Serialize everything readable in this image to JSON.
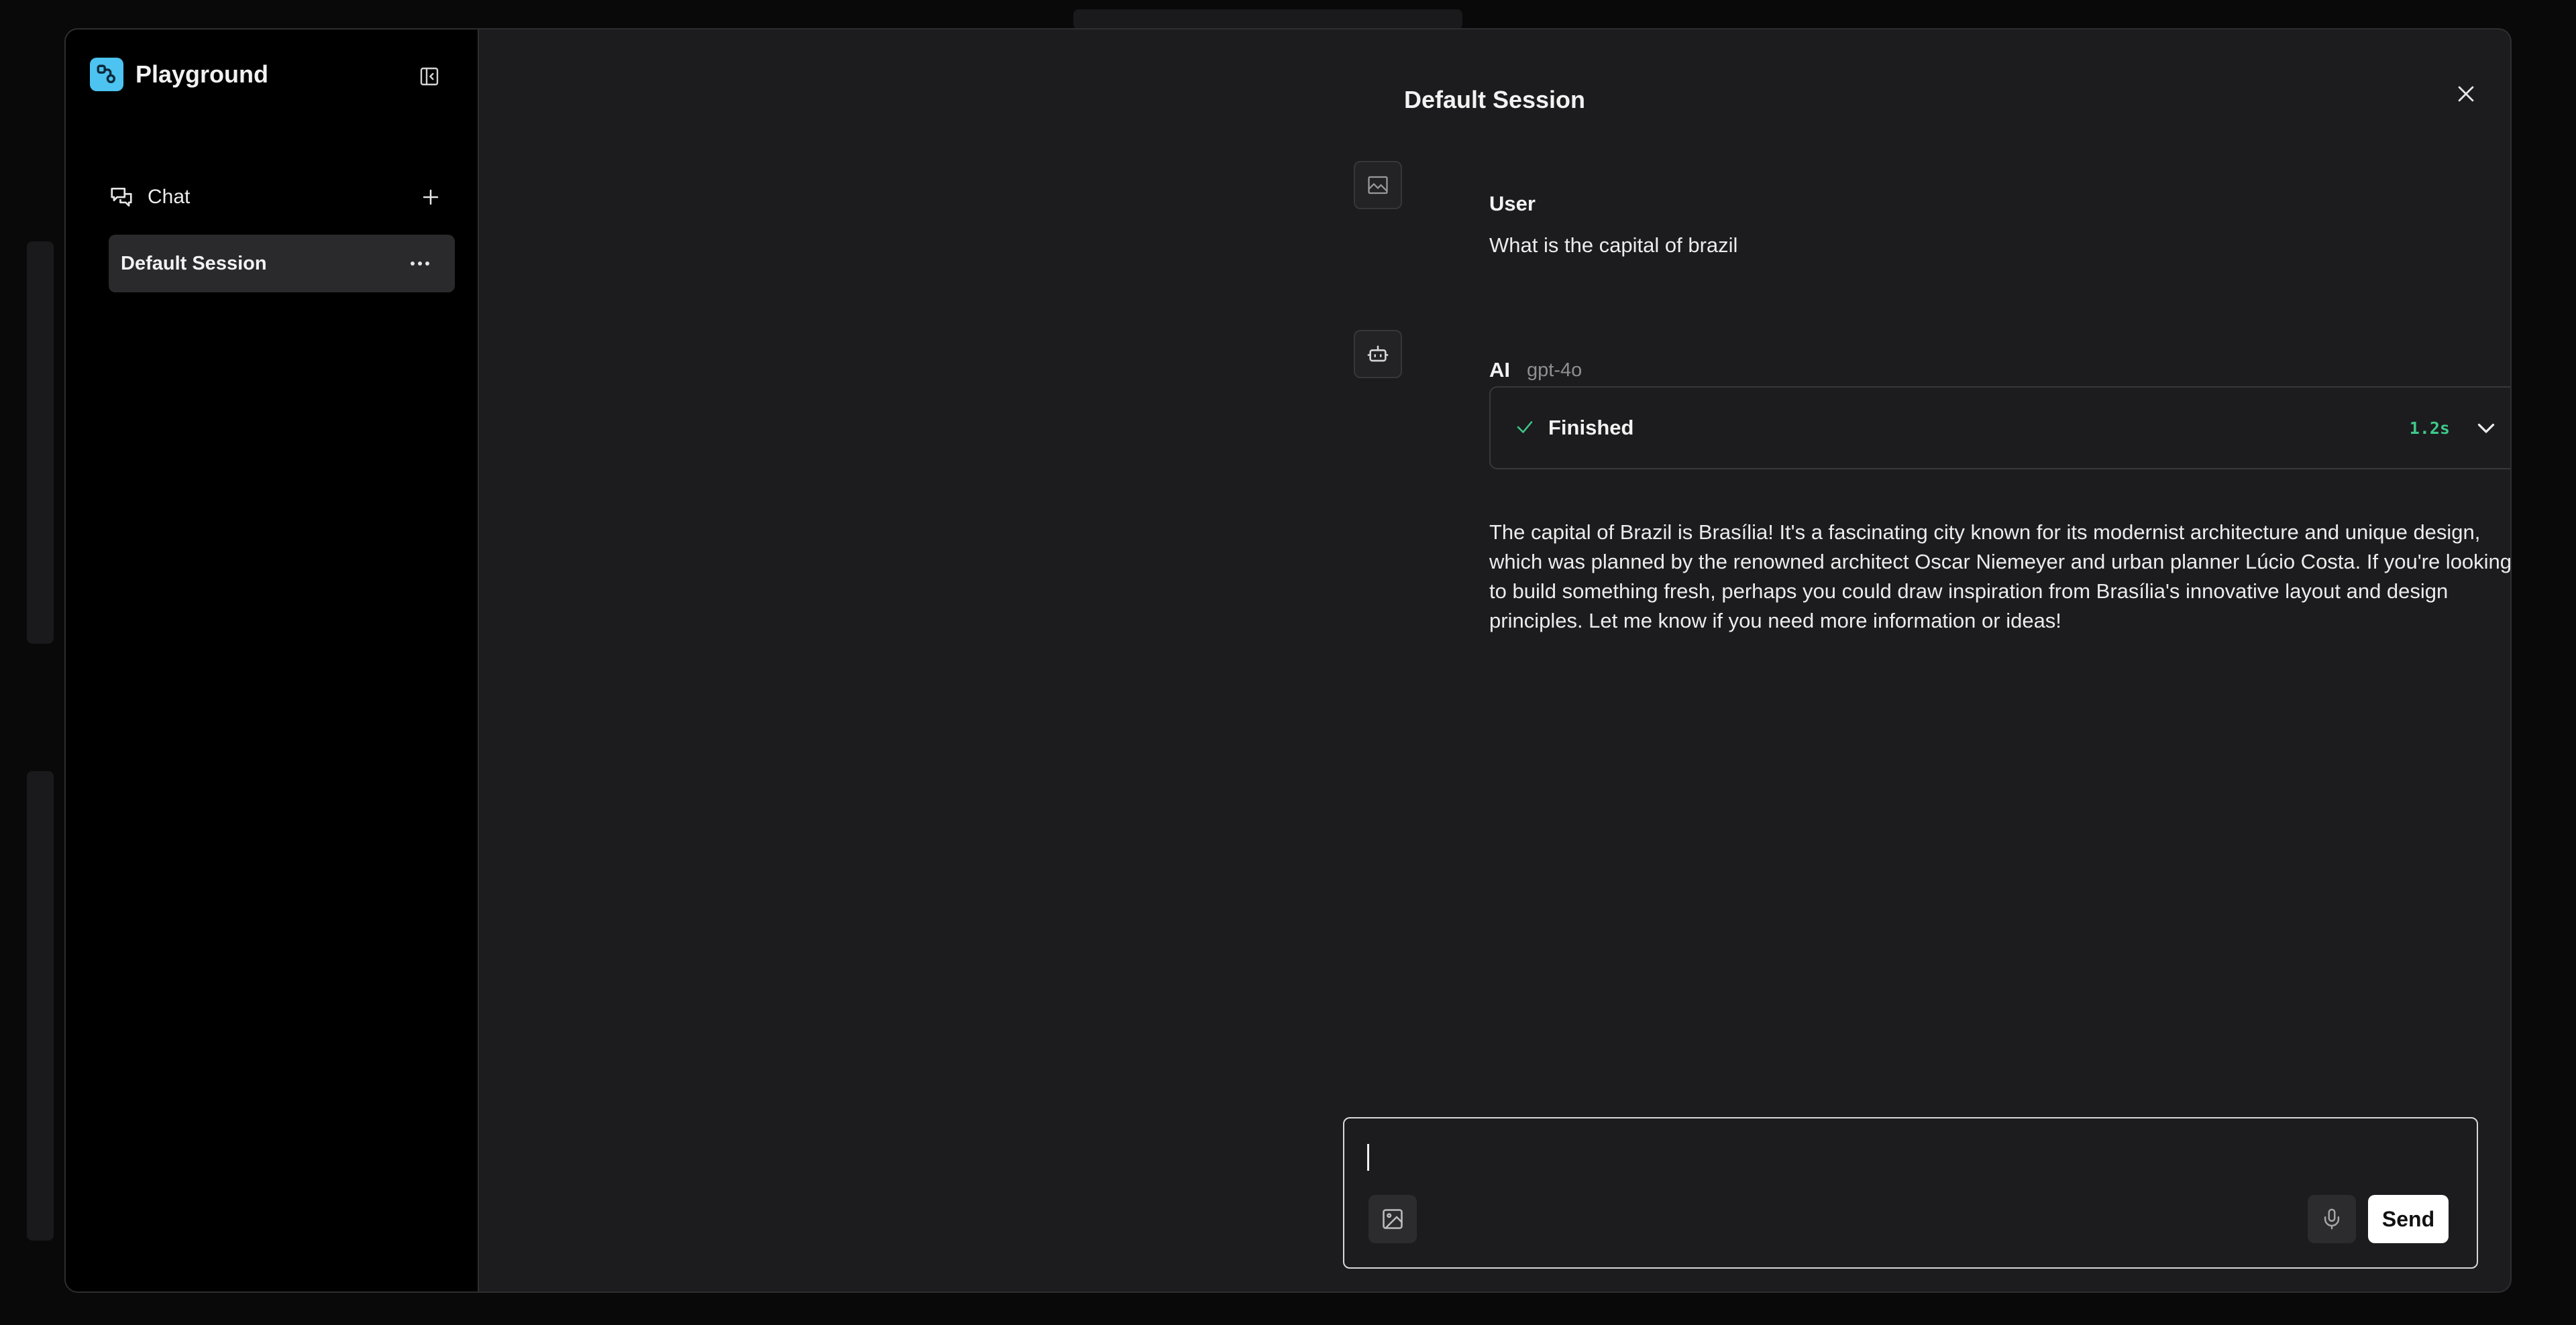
{
  "sidebar": {
    "brand": "Playground",
    "chat_label": "Chat",
    "sessions": [
      {
        "label": "Default Session",
        "active": true
      }
    ]
  },
  "main": {
    "title": "Default Session",
    "messages": [
      {
        "role": "user",
        "name": "User",
        "text": "What is the capital of brazil"
      },
      {
        "role": "ai",
        "name": "AI",
        "model": "gpt-4o",
        "status": {
          "label": "Finished",
          "duration": "1.2s"
        },
        "text": "The capital of Brazil is Brasília! It's a fascinating city known for its modernist architecture and unique design, which was planned by the renowned architect Oscar Niemeyer and urban planner Lúcio Costa. If you're looking to build something fresh, perhaps you could draw inspiration from Brasília's innovative layout and design principles. Let me know if you need more information or ideas!"
      }
    ]
  },
  "composer": {
    "value": "",
    "send_label": "Send"
  },
  "colors": {
    "accent_logo": "#4cc3f0",
    "status_time": "#3ec98a",
    "sidebar_bg": "#000000",
    "main_bg": "#1c1c1e"
  },
  "icons": {
    "brand": "nodes-logo-icon",
    "collapse": "sidebar-collapse-icon",
    "chat": "chat-bubbles-icon",
    "add": "plus-icon",
    "more": "ellipsis-icon",
    "close": "close-icon",
    "user_avatar": "broken-image-icon",
    "ai_avatar": "bot-icon",
    "status": "check-icon",
    "expand": "chevron-down-icon",
    "image": "image-icon",
    "mic": "microphone-icon"
  }
}
